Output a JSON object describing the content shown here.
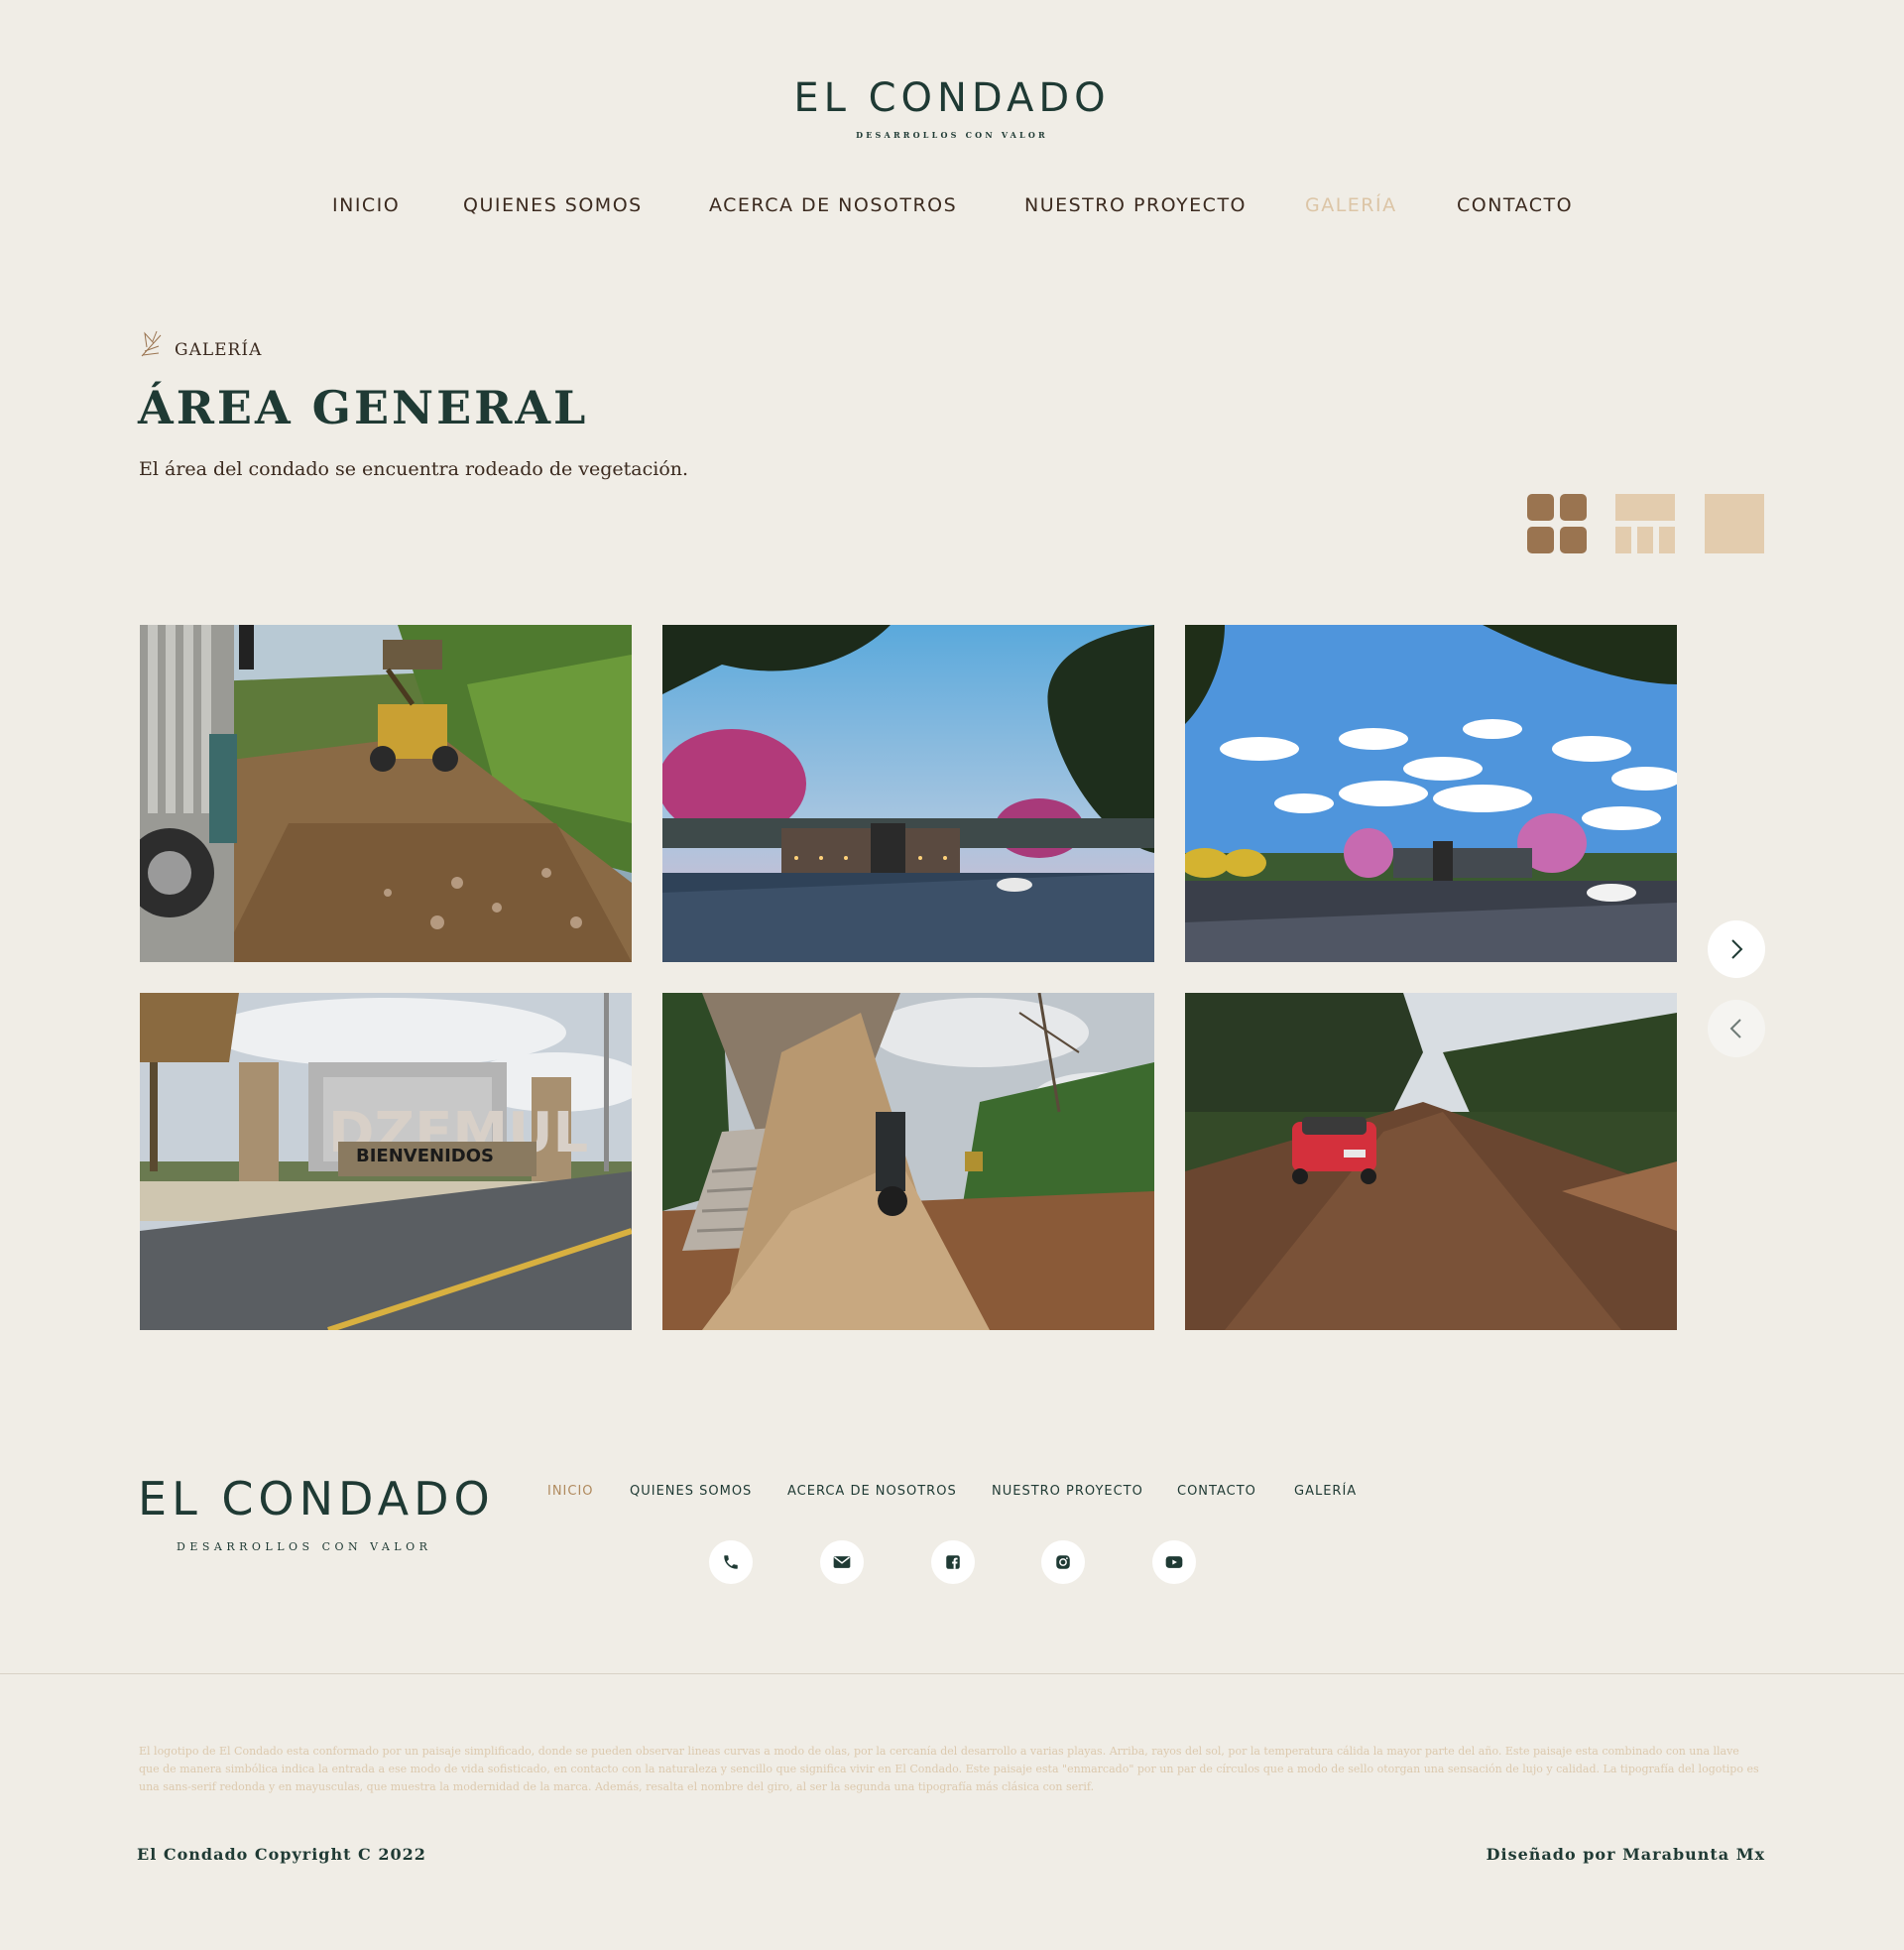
{
  "brand": {
    "name": "EL CONDADO",
    "tagline": "DESARROLLOS CON VALOR"
  },
  "nav": {
    "items": [
      {
        "label": "INICIO",
        "active": false
      },
      {
        "label": "QUIENES SOMOS",
        "active": false
      },
      {
        "label": "ACERCA DE NOSOTROS",
        "active": false
      },
      {
        "label": "NUESTRO PROYECTO",
        "active": false
      },
      {
        "label": "GALERÍA",
        "active": true
      },
      {
        "label": "CONTACTO",
        "active": false
      }
    ]
  },
  "section": {
    "icon": "leaf-sketch-icon",
    "eyebrow": "GALERÍA",
    "title": "ÁREA GENERAL",
    "description": "El área del condado se encuentra rodeado de vegetación."
  },
  "layout_options": [
    {
      "icon": "grid-2x2-icon",
      "selected": true
    },
    {
      "icon": "grid-mixed-icon",
      "selected": false
    },
    {
      "icon": "single-view-icon",
      "selected": false
    }
  ],
  "gallery": {
    "photos": [
      {
        "subject": "backhoe-clearing-dirt-road"
      },
      {
        "subject": "entrance-render-dusk"
      },
      {
        "subject": "entrance-render-day"
      },
      {
        "subject": "dzemul-welcome-sign"
      },
      {
        "subject": "dump-truck-unloading"
      },
      {
        "subject": "red-car-on-dirt-road"
      }
    ],
    "sign_text_1": "DZEMUL",
    "sign_text_2": "BIENVENIDOS",
    "next_icon": "chevron-right-icon",
    "prev_icon": "chevron-left-icon"
  },
  "footer": {
    "brand": "EL CONDADO",
    "tagline": "DESARROLLOS CON VALOR",
    "nav": [
      {
        "label": "INICIO",
        "active": true
      },
      {
        "label": "QUIENES SOMOS",
        "active": false
      },
      {
        "label": "ACERCA DE NOSOTROS",
        "active": false
      },
      {
        "label": "NUESTRO PROYECTO",
        "active": false
      },
      {
        "label": "CONTACTO",
        "active": false
      },
      {
        "label": "GALERÍA",
        "active": false
      }
    ],
    "social": [
      "phone-icon",
      "mail-icon",
      "facebook-icon",
      "instagram-icon",
      "youtube-icon"
    ],
    "fine_print": "El logotipo de El Condado esta conformado por un paisaje simplificado, donde se pueden observar lineas curvas a modo de olas, por la cercanía del desarrollo a varias playas. Arriba, rayos del sol, por la temperatura cálida la mayor parte del año. Este paisaje esta combinado con una llave que de manera simbólica indica la entrada a ese modo de vida sofisticado, en contacto con la naturaleza y sencillo que significa vivir en El Condado. Este paisaje esta \"enmarcado\" por un par de círculos que a modo de sello otorgan una sensación de lujo y calidad. La tipografía del logotipo es una sans-serif redonda y en mayusculas, que muestra la modernidad de la marca. Además, resalta el nombre del giro, al ser la segunda una tipografía más clásica con serif.",
    "copyright": "El Condado Copyright C 2022",
    "designer": "Diseñado por Marabunta Mx"
  },
  "colors": {
    "background": "#f0ede6",
    "primary_dark_green": "#1f3a34",
    "brown_text": "#3b2a1f",
    "accent_tan": "#dcc5a6",
    "accent_brown": "#9a7450"
  }
}
